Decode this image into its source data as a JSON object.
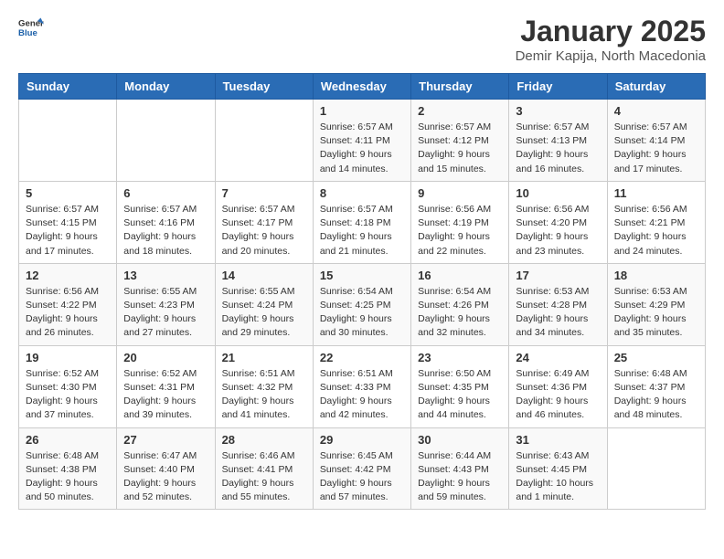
{
  "logo": {
    "general": "General",
    "blue": "Blue"
  },
  "title": "January 2025",
  "subtitle": "Demir Kapija, North Macedonia",
  "weekdays": [
    "Sunday",
    "Monday",
    "Tuesday",
    "Wednesday",
    "Thursday",
    "Friday",
    "Saturday"
  ],
  "weeks": [
    [
      {
        "day": "",
        "detail": ""
      },
      {
        "day": "",
        "detail": ""
      },
      {
        "day": "",
        "detail": ""
      },
      {
        "day": "1",
        "detail": "Sunrise: 6:57 AM\nSunset: 4:11 PM\nDaylight: 9 hours\nand 14 minutes."
      },
      {
        "day": "2",
        "detail": "Sunrise: 6:57 AM\nSunset: 4:12 PM\nDaylight: 9 hours\nand 15 minutes."
      },
      {
        "day": "3",
        "detail": "Sunrise: 6:57 AM\nSunset: 4:13 PM\nDaylight: 9 hours\nand 16 minutes."
      },
      {
        "day": "4",
        "detail": "Sunrise: 6:57 AM\nSunset: 4:14 PM\nDaylight: 9 hours\nand 17 minutes."
      }
    ],
    [
      {
        "day": "5",
        "detail": "Sunrise: 6:57 AM\nSunset: 4:15 PM\nDaylight: 9 hours\nand 17 minutes."
      },
      {
        "day": "6",
        "detail": "Sunrise: 6:57 AM\nSunset: 4:16 PM\nDaylight: 9 hours\nand 18 minutes."
      },
      {
        "day": "7",
        "detail": "Sunrise: 6:57 AM\nSunset: 4:17 PM\nDaylight: 9 hours\nand 20 minutes."
      },
      {
        "day": "8",
        "detail": "Sunrise: 6:57 AM\nSunset: 4:18 PM\nDaylight: 9 hours\nand 21 minutes."
      },
      {
        "day": "9",
        "detail": "Sunrise: 6:56 AM\nSunset: 4:19 PM\nDaylight: 9 hours\nand 22 minutes."
      },
      {
        "day": "10",
        "detail": "Sunrise: 6:56 AM\nSunset: 4:20 PM\nDaylight: 9 hours\nand 23 minutes."
      },
      {
        "day": "11",
        "detail": "Sunrise: 6:56 AM\nSunset: 4:21 PM\nDaylight: 9 hours\nand 24 minutes."
      }
    ],
    [
      {
        "day": "12",
        "detail": "Sunrise: 6:56 AM\nSunset: 4:22 PM\nDaylight: 9 hours\nand 26 minutes."
      },
      {
        "day": "13",
        "detail": "Sunrise: 6:55 AM\nSunset: 4:23 PM\nDaylight: 9 hours\nand 27 minutes."
      },
      {
        "day": "14",
        "detail": "Sunrise: 6:55 AM\nSunset: 4:24 PM\nDaylight: 9 hours\nand 29 minutes."
      },
      {
        "day": "15",
        "detail": "Sunrise: 6:54 AM\nSunset: 4:25 PM\nDaylight: 9 hours\nand 30 minutes."
      },
      {
        "day": "16",
        "detail": "Sunrise: 6:54 AM\nSunset: 4:26 PM\nDaylight: 9 hours\nand 32 minutes."
      },
      {
        "day": "17",
        "detail": "Sunrise: 6:53 AM\nSunset: 4:28 PM\nDaylight: 9 hours\nand 34 minutes."
      },
      {
        "day": "18",
        "detail": "Sunrise: 6:53 AM\nSunset: 4:29 PM\nDaylight: 9 hours\nand 35 minutes."
      }
    ],
    [
      {
        "day": "19",
        "detail": "Sunrise: 6:52 AM\nSunset: 4:30 PM\nDaylight: 9 hours\nand 37 minutes."
      },
      {
        "day": "20",
        "detail": "Sunrise: 6:52 AM\nSunset: 4:31 PM\nDaylight: 9 hours\nand 39 minutes."
      },
      {
        "day": "21",
        "detail": "Sunrise: 6:51 AM\nSunset: 4:32 PM\nDaylight: 9 hours\nand 41 minutes."
      },
      {
        "day": "22",
        "detail": "Sunrise: 6:51 AM\nSunset: 4:33 PM\nDaylight: 9 hours\nand 42 minutes."
      },
      {
        "day": "23",
        "detail": "Sunrise: 6:50 AM\nSunset: 4:35 PM\nDaylight: 9 hours\nand 44 minutes."
      },
      {
        "day": "24",
        "detail": "Sunrise: 6:49 AM\nSunset: 4:36 PM\nDaylight: 9 hours\nand 46 minutes."
      },
      {
        "day": "25",
        "detail": "Sunrise: 6:48 AM\nSunset: 4:37 PM\nDaylight: 9 hours\nand 48 minutes."
      }
    ],
    [
      {
        "day": "26",
        "detail": "Sunrise: 6:48 AM\nSunset: 4:38 PM\nDaylight: 9 hours\nand 50 minutes."
      },
      {
        "day": "27",
        "detail": "Sunrise: 6:47 AM\nSunset: 4:40 PM\nDaylight: 9 hours\nand 52 minutes."
      },
      {
        "day": "28",
        "detail": "Sunrise: 6:46 AM\nSunset: 4:41 PM\nDaylight: 9 hours\nand 55 minutes."
      },
      {
        "day": "29",
        "detail": "Sunrise: 6:45 AM\nSunset: 4:42 PM\nDaylight: 9 hours\nand 57 minutes."
      },
      {
        "day": "30",
        "detail": "Sunrise: 6:44 AM\nSunset: 4:43 PM\nDaylight: 9 hours\nand 59 minutes."
      },
      {
        "day": "31",
        "detail": "Sunrise: 6:43 AM\nSunset: 4:45 PM\nDaylight: 10 hours\nand 1 minute."
      },
      {
        "day": "",
        "detail": ""
      }
    ]
  ]
}
